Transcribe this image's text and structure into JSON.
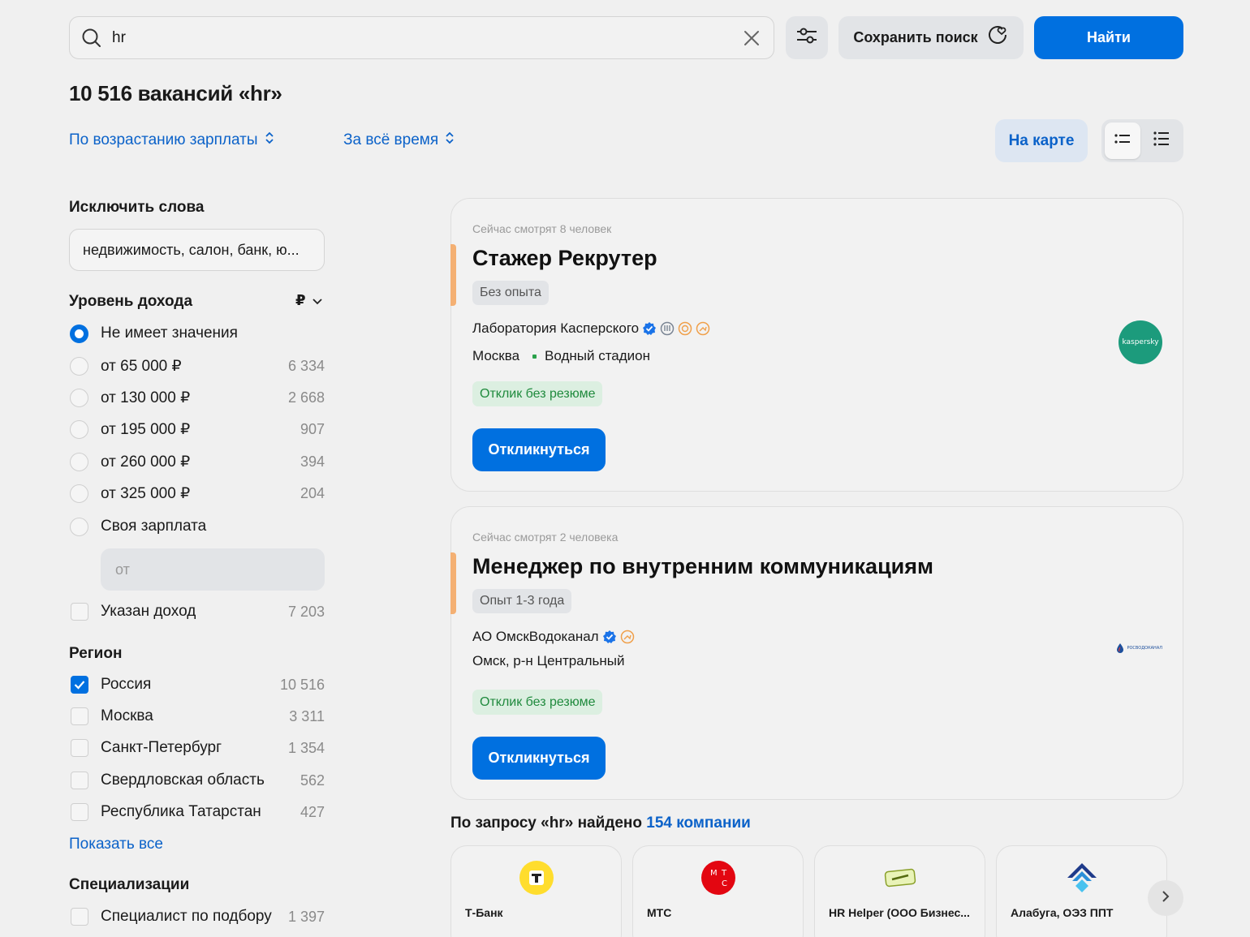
{
  "search": {
    "value": "hr",
    "save_label": "Сохранить поиск",
    "find_label": "Найти"
  },
  "results": {
    "title": "10 516 вакансий «hr»"
  },
  "sorting": {
    "order_label": "По возрастанию зарплаты",
    "period_label": "За всё время",
    "map_label": "На карте"
  },
  "sidebar": {
    "exclude": {
      "title": "Исключить слова",
      "value": "недвижимость, салон, банк, ю..."
    },
    "income": {
      "title": "Уровень дохода",
      "currency": "₽",
      "options": [
        {
          "label": "Не имеет значения",
          "count": "",
          "checked": true
        },
        {
          "label": "от 65 000 ₽",
          "count": "6 334",
          "checked": false
        },
        {
          "label": "от 130 000 ₽",
          "count": "2 668",
          "checked": false
        },
        {
          "label": "от 195 000 ₽",
          "count": "907",
          "checked": false
        },
        {
          "label": "от 260 000 ₽",
          "count": "394",
          "checked": false
        },
        {
          "label": "от 325 000 ₽",
          "count": "204",
          "checked": false
        },
        {
          "label": "Своя зарплата",
          "count": "",
          "checked": false
        }
      ],
      "custom_placeholder": "от",
      "specified": {
        "label": "Указан доход",
        "count": "7 203",
        "checked": false
      }
    },
    "region": {
      "title": "Регион",
      "options": [
        {
          "label": "Россия",
          "count": "10 516",
          "checked": true
        },
        {
          "label": "Москва",
          "count": "3 311",
          "checked": false
        },
        {
          "label": "Санкт-Петербург",
          "count": "1 354",
          "checked": false
        },
        {
          "label": "Свердловская область",
          "count": "562",
          "checked": false
        },
        {
          "label": "Республика Татарстан",
          "count": "427",
          "checked": false
        }
      ],
      "show_all": "Показать все"
    },
    "specializations": {
      "title": "Специализации",
      "options": [
        {
          "label": "Специалист по подбору",
          "count": "1 397",
          "checked": false
        }
      ]
    }
  },
  "vacancies": [
    {
      "watching": "Сейчас смотрят 8 человек",
      "title": "Стажер Рекрутер",
      "experience": "Без опыта",
      "company": "Лаборатория Касперского",
      "city": "Москва",
      "metro": "Водный стадион",
      "no_resume": "Отклик без резюме",
      "apply": "Откликнуться",
      "logo_text": "kaspersky",
      "logo_color": "#1c9b7c"
    },
    {
      "watching": "Сейчас смотрят 2 человека",
      "title": "Менеджер по внутренним коммуникациям",
      "experience": "Опыт 1-3 года",
      "company": "АО ОмскВодоканал",
      "city": "Омск, р-н Центральный",
      "metro": "",
      "no_resume": "Отклик без резюме",
      "apply": "Откликнуться",
      "logo_text": "РОСВОДОКАНАЛ",
      "logo_color": "#1d4f9c"
    }
  ],
  "companies": {
    "prefix": "По запросу «hr» найдено",
    "link": "154 компании",
    "items": [
      {
        "name": "Т-Банк",
        "icon": "tbank-logo"
      },
      {
        "name": "МТС",
        "icon": "mts-logo"
      },
      {
        "name": "HR Helper (ООО Бизнес...",
        "icon": "hr-helper-logo"
      },
      {
        "name": "Алабуга, ОЭЗ ППТ",
        "icon": "alabuga-logo"
      }
    ]
  },
  "colors": {
    "accent": "#0070e0",
    "link": "#0b62c9",
    "success": "#1f8a3d",
    "highlight": "#f4b073"
  }
}
